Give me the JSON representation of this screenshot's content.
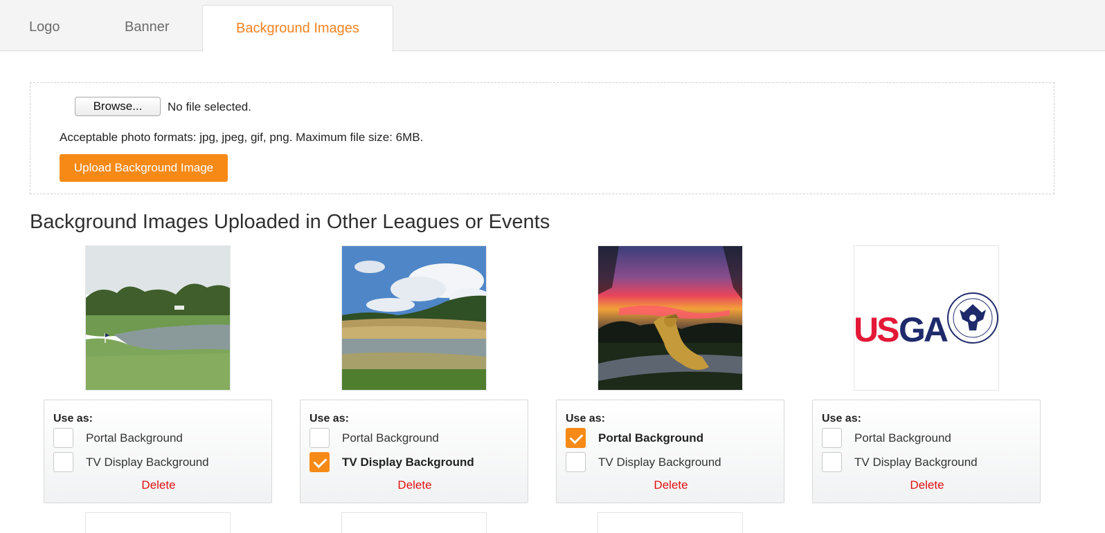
{
  "tabs": [
    {
      "label": "Logo"
    },
    {
      "label": "Banner"
    },
    {
      "label": "Background Images",
      "active": true
    }
  ],
  "upload": {
    "browse_label": "Browse...",
    "file_status": "No file selected.",
    "formats_note": "Acceptable photo formats: jpg, jpeg, gif, png. Maximum file size: 6MB.",
    "upload_button": "Upload Background Image"
  },
  "section_heading": "Background Images Uploaded in Other Leagues or Events",
  "cards": [
    {
      "use_as": "Use as:",
      "portal_label": "Portal Background",
      "tv_label": "TV Display Background",
      "portal_checked": false,
      "tv_checked": false,
      "delete_label": "Delete",
      "image": "golf-course-pond-icon"
    },
    {
      "use_as": "Use as:",
      "portal_label": "Portal Background",
      "tv_label": "TV Display Background",
      "portal_checked": false,
      "tv_checked": true,
      "delete_label": "Delete",
      "image": "golf-course-sky-icon"
    },
    {
      "use_as": "Use as:",
      "portal_label": "Portal Background",
      "tv_label": "TV Display Background",
      "portal_checked": true,
      "tv_checked": false,
      "delete_label": "Delete",
      "image": "sunset-statue-icon"
    },
    {
      "use_as": "Use as:",
      "portal_label": "Portal Background",
      "tv_label": "TV Display Background",
      "portal_checked": false,
      "tv_checked": false,
      "delete_label": "Delete",
      "image": "usga-logo",
      "logo_text": "USGA"
    }
  ],
  "colors": {
    "accent": "#f78a16",
    "delete": "#e01010",
    "usga_red": "#e31937",
    "usga_blue": "#1f2a6b"
  }
}
